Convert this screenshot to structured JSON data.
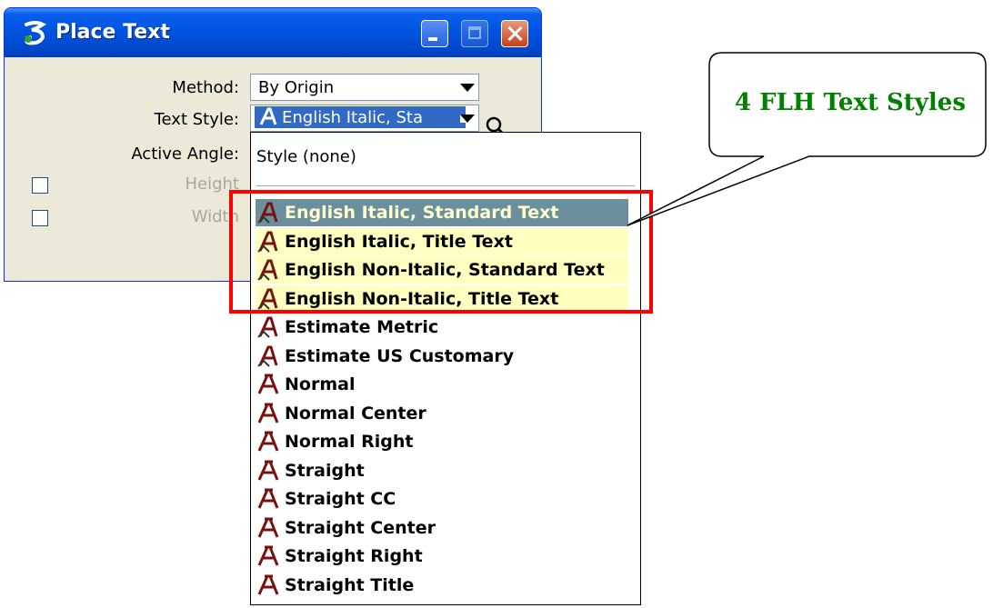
{
  "window": {
    "title": "Place Text"
  },
  "form": {
    "method_label": "Method:",
    "method_value": "By Origin",
    "text_style_label": "Text Style:",
    "text_style_value": "English Italic, Sta",
    "active_angle_label": "Active Angle:",
    "height_label": "Height",
    "width_label": "Width"
  },
  "dropdown": {
    "none_option": "Style (none)",
    "items": [
      {
        "label": "English Italic, Standard Text",
        "icon": "text-style-italic-icon",
        "highlighted": true,
        "selected": true
      },
      {
        "label": "English Italic, Title Text",
        "icon": "text-style-italic-icon",
        "highlighted": true
      },
      {
        "label": "English Non-Italic, Standard Text",
        "icon": "text-style-italic-icon",
        "highlighted": true
      },
      {
        "label": "English Non-Italic, Title Text",
        "icon": "text-style-italic-icon",
        "highlighted": true
      },
      {
        "label": "Estimate Metric",
        "icon": "text-style-italic-icon"
      },
      {
        "label": "Estimate US Customary",
        "icon": "text-style-italic-icon"
      },
      {
        "label": "Normal",
        "icon": "text-style-icon"
      },
      {
        "label": "Normal Center",
        "icon": "text-style-icon"
      },
      {
        "label": "Normal Right",
        "icon": "text-style-icon"
      },
      {
        "label": "Straight",
        "icon": "text-style-icon"
      },
      {
        "label": "Straight CC",
        "icon": "text-style-icon"
      },
      {
        "label": "Straight Center",
        "icon": "text-style-icon"
      },
      {
        "label": "Straight Right",
        "icon": "text-style-icon"
      },
      {
        "label": "Straight Title",
        "icon": "text-style-icon"
      }
    ]
  },
  "callout": {
    "text": "4 FLH Text Styles"
  },
  "colors": {
    "callout_text": "#008000",
    "highlight_box": "#ff0000",
    "highlight_fill": "#ffffc0",
    "selected_fill": "#6b8f9c"
  }
}
